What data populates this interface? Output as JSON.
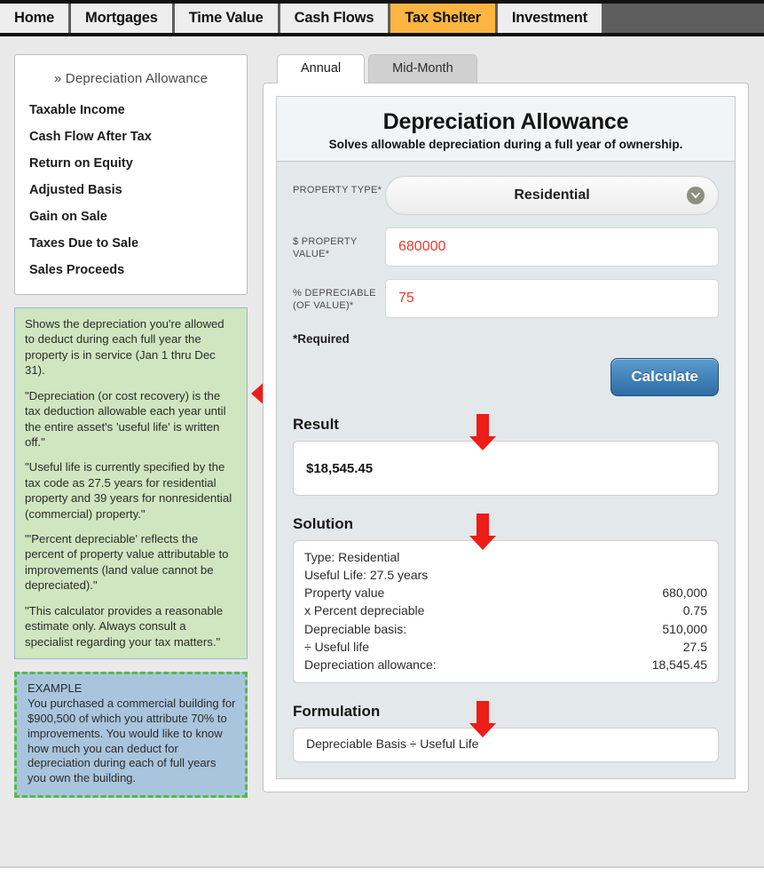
{
  "nav": {
    "items": [
      {
        "label": "Home",
        "active": false
      },
      {
        "label": "Mortgages",
        "active": false
      },
      {
        "label": "Time Value",
        "active": false
      },
      {
        "label": "Cash Flows",
        "active": false
      },
      {
        "label": "Tax Shelter",
        "active": true
      },
      {
        "label": "Investment",
        "active": false
      }
    ],
    "active_color": "#fbb540",
    "bar_color": "#5e5e5e"
  },
  "sidebar": {
    "current": "» Depreciation Allowance",
    "items": [
      {
        "label": "Taxable Income"
      },
      {
        "label": "Cash Flow After Tax"
      },
      {
        "label": "Return on Equity"
      },
      {
        "label": "Adjusted Basis"
      },
      {
        "label": "Gain on Sale"
      },
      {
        "label": "Taxes Due to Sale"
      },
      {
        "label": "Sales Proceeds"
      }
    ]
  },
  "notes": {
    "background": "#cfe6c0",
    "paragraphs": [
      "Shows the depreciation you're allowed to deduct during each full year the property is in service (Jan 1 thru Dec 31).",
      "\"Depreciation (or cost recovery) is the tax deduction allowable each year until the entire asset's 'useful life' is written off.\"",
      "\"Useful life is currently specified by the tax code as 27.5 years for residential property and 39 years for nonresidential (commercial) property.\"",
      "\"'Percent depreciable' reflects the percent of property value attributable to improvements (land value cannot be depreciated).\"",
      "\"This calculator provides a reasonable estimate only. Always consult a specialist regarding your tax matters.\""
    ]
  },
  "example": {
    "background": "#a9c5dd",
    "border_color": "#56b848",
    "text": "EXAMPLE\nYou purchased a commercial building for $900,500 of which you attribute 70% to improvements. You would like to know how much you can deduct for depreciation during each of full years you own the building."
  },
  "tabs": [
    {
      "label": "Annual",
      "active": true
    },
    {
      "label": "Mid-Month",
      "active": false
    }
  ],
  "calculator": {
    "title": "Depreciation Allowance",
    "subtitle": "Solves allowable depreciation during a full year of ownership.",
    "fields": {
      "property_type": {
        "label": "PROPERTY TYPE*",
        "value": "Residential",
        "chevron_icon": "chevron-down-icon"
      },
      "property_value": {
        "label": "$ PROPERTY VALUE*",
        "value": "680000",
        "placeholder": "",
        "value_color": "#f03a2e"
      },
      "percent_depreciable": {
        "label": "% DEPRECIABLE (OF VALUE)*",
        "value": "75",
        "placeholder": "",
        "value_color": "#f03a2e"
      }
    },
    "required_note": "*Required",
    "calculate_label": "Calculate"
  },
  "result": {
    "title": "Result",
    "value": "$18,545.45"
  },
  "solution": {
    "title": "Solution",
    "lines": [
      {
        "label": "Type: Residential",
        "value": ""
      },
      {
        "label": "Useful Life: 27.5 years",
        "value": ""
      },
      {
        "label": "Property value",
        "value": "680,000"
      },
      {
        "label": "x Percent depreciable",
        "value": "0.75"
      },
      {
        "label": "Depreciable basis:",
        "value": "510,000"
      },
      {
        "label": "÷ Useful life",
        "value": "27.5"
      },
      {
        "label": "Depreciation allowance:",
        "value": "18,545.45"
      }
    ]
  },
  "formulation": {
    "title": "Formulation",
    "text": "Depreciable Basis ÷ Useful Life"
  },
  "annotations": {
    "arrow_color": "#ee1c18",
    "left_arrow": "arrow-left-icon",
    "down_arrow": "arrow-down-icon"
  }
}
